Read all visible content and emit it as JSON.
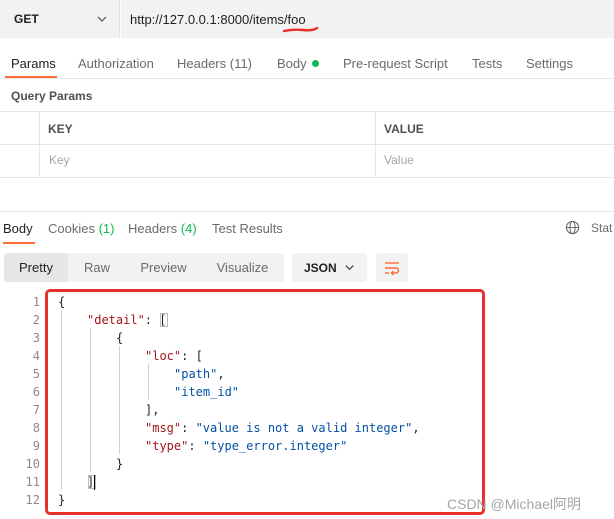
{
  "request": {
    "method": "GET",
    "url": "http://127.0.0.1:8000/items/foo"
  },
  "request_tabs": {
    "params": "Params",
    "authorization": "Authorization",
    "headers": "Headers",
    "headers_count": "(11)",
    "body": "Body",
    "prerequest": "Pre-request Script",
    "tests": "Tests",
    "settings": "Settings"
  },
  "query_params": {
    "title": "Query Params",
    "key_header": "KEY",
    "value_header": "VALUE",
    "key_placeholder": "Key",
    "value_placeholder": "Value"
  },
  "response_tabs": {
    "body": "Body",
    "cookies": "Cookies",
    "cookies_count": "(1)",
    "headers": "Headers",
    "headers_count": "(4)",
    "test_results": "Test Results",
    "status_truncated": "Stat"
  },
  "format_toolbar": {
    "pretty": "Pretty",
    "raw": "Raw",
    "preview": "Preview",
    "visualize": "Visualize",
    "language": "JSON"
  },
  "code": {
    "line_numbers": [
      "1",
      "2",
      "3",
      "4",
      "5",
      "6",
      "7",
      "8",
      "9",
      "10",
      "11",
      "12"
    ],
    "key_detail": "\"detail\"",
    "key_loc": "\"loc\"",
    "val_path": "\"path\"",
    "val_item_id": "\"item_id\"",
    "key_msg": "\"msg\"",
    "val_msg": "\"value is not a valid integer\"",
    "key_type": "\"type\"",
    "val_type": "\"type_error.integer\""
  },
  "watermark": "CSDN @Michael阿明",
  "colors": {
    "accent": "#ff6c37",
    "success": "#0cbb52",
    "annotation": "#e8302b",
    "json_key": "#a31515",
    "json_string": "#0451a5"
  }
}
